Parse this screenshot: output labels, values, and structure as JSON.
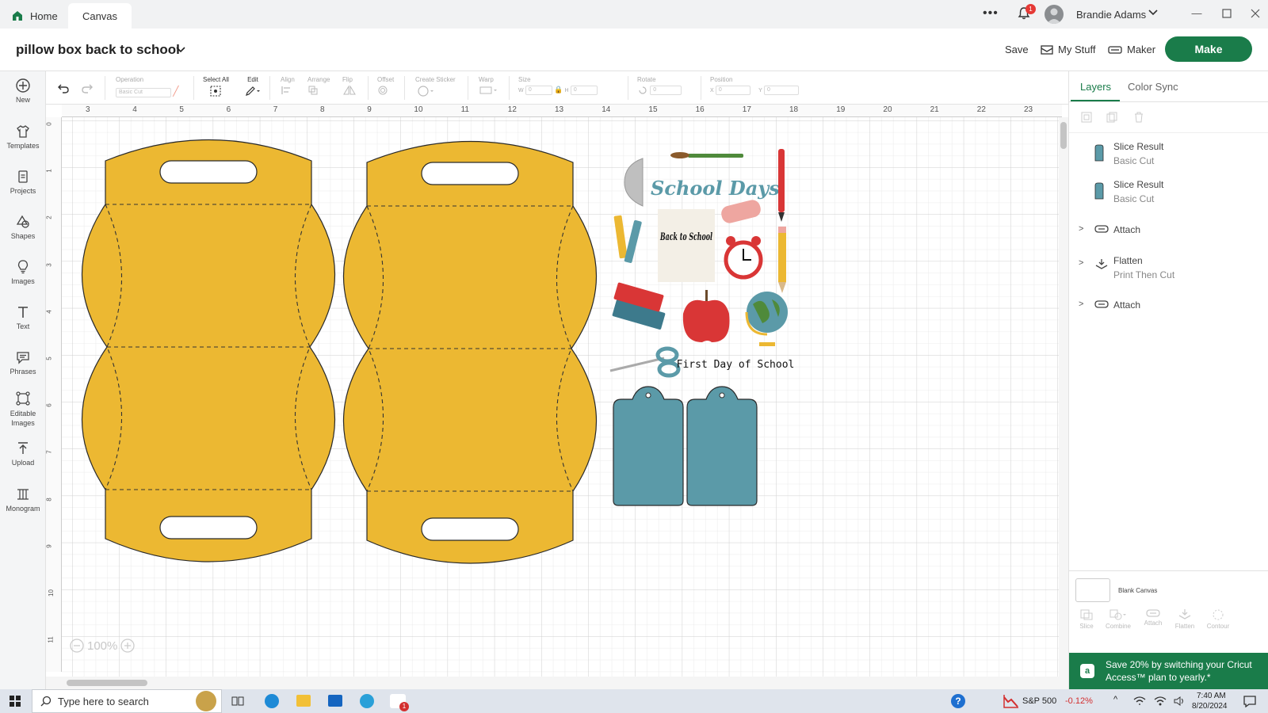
{
  "tabs": {
    "home": "Home",
    "canvas": "Canvas"
  },
  "user": {
    "name": "Brandie Adams",
    "notifications": "1"
  },
  "header": {
    "title": "pillow box back to school",
    "save": "Save",
    "my_stuff": "My Stuff",
    "maker": "Maker",
    "make": "Make"
  },
  "leftbar": [
    {
      "label": "New",
      "icon": "plus-circle-icon"
    },
    {
      "label": "Templates",
      "icon": "shirt-icon"
    },
    {
      "label": "Projects",
      "icon": "projects-icon"
    },
    {
      "label": "Shapes",
      "icon": "shapes-icon"
    },
    {
      "label": "Images",
      "icon": "lightbulb-icon"
    },
    {
      "label": "Text",
      "icon": "text-icon"
    },
    {
      "label": "Phrases",
      "icon": "speech-bubble-icon"
    },
    {
      "label": "Editable Images",
      "icon": "editable-images-icon"
    },
    {
      "label": "Upload",
      "icon": "upload-icon"
    },
    {
      "label": "Monogram",
      "icon": "monogram-icon"
    }
  ],
  "toolbar": {
    "operation": "Operation",
    "operation_value": "Basic Cut",
    "select_all": "Select All",
    "edit": "Edit",
    "align": "Align",
    "arrange": "Arrange",
    "flip": "Flip",
    "offset": "Offset",
    "create_sticker": "Create Sticker",
    "warp": "Warp",
    "size": "Size",
    "size_w": "W",
    "size_h": "H",
    "rotate": "Rotate",
    "position": "Position",
    "pos_x": "X",
    "pos_y": "Y",
    "field_zero": "0"
  },
  "ruler": {
    "top": [
      "3",
      "4",
      "5",
      "6",
      "7",
      "8",
      "9",
      "10",
      "11",
      "12",
      "13",
      "14",
      "15",
      "16",
      "17",
      "18",
      "19",
      "20",
      "21",
      "22",
      "23"
    ],
    "left": [
      "0",
      "1",
      "2",
      "3",
      "4",
      "5",
      "6",
      "7",
      "8",
      "9",
      "10",
      "11"
    ]
  },
  "canvas": {
    "zoom": "100%",
    "school_days": "School Days",
    "back_to_school": "Back to School",
    "first_day": "First Day of School"
  },
  "right_panel": {
    "tab_layers": "Layers",
    "tab_color_sync": "Color Sync",
    "layers": [
      {
        "name": "Slice Result",
        "sub": "Basic Cut",
        "type": "slice"
      },
      {
        "name": "Slice Result",
        "sub": "Basic Cut",
        "type": "slice"
      },
      {
        "name": "Attach",
        "sub": "",
        "type": "attach"
      },
      {
        "name": "Flatten",
        "sub": "Print Then Cut",
        "type": "flatten"
      },
      {
        "name": "Attach",
        "sub": "",
        "type": "attach"
      }
    ],
    "blank_canvas": "Blank Canvas",
    "bottom_tools": [
      "Slice",
      "Combine",
      "Attach",
      "Flatten",
      "Contour"
    ],
    "promo": "Save 20% by switching your Cricut Access™ plan to yearly.*"
  },
  "taskbar": {
    "search_placeholder": "Type here to search",
    "stock_name": "S&P 500",
    "stock_change": "-0.12%",
    "time": "7:40 AM",
    "date": "8/20/2024",
    "notif_count": "1"
  },
  "colors": {
    "brand_green": "#1a7c4a",
    "box_yellow": "#ecb832",
    "tag_teal": "#5b9aa8"
  }
}
